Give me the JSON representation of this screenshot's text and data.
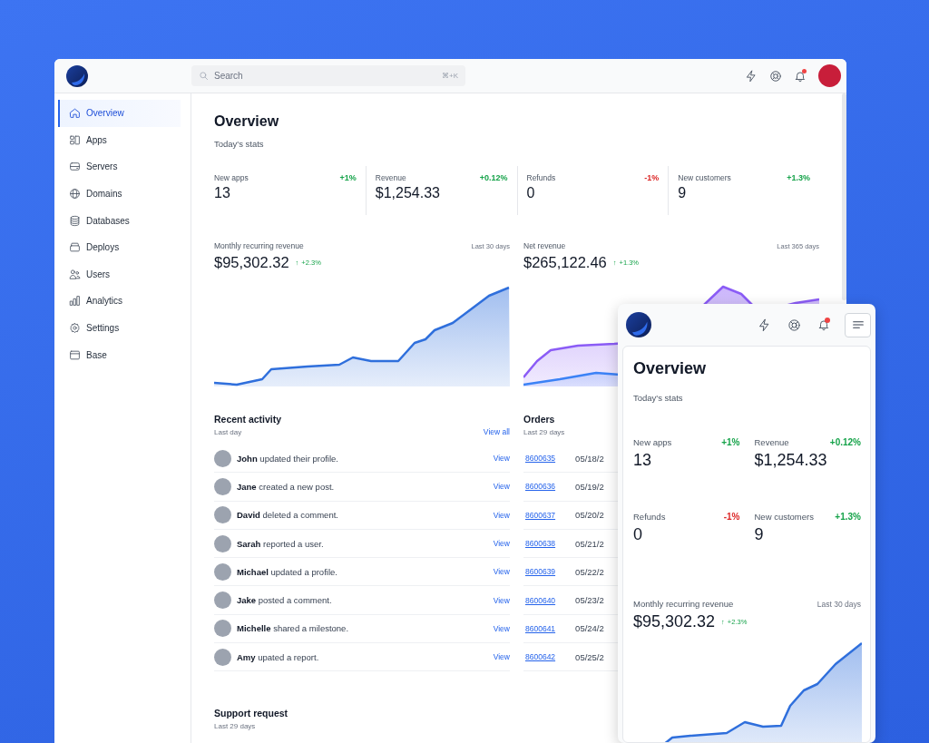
{
  "desktop": {
    "search": {
      "placeholder": "Search",
      "shortcut": "⌘+K"
    },
    "notifications": {
      "unread": true
    },
    "sidebar": {
      "items": [
        {
          "label": "Overview",
          "selected": true
        },
        {
          "label": "Apps",
          "selected": false
        },
        {
          "label": "Servers",
          "selected": false
        },
        {
          "label": "Domains",
          "selected": false
        },
        {
          "label": "Databases",
          "selected": false
        },
        {
          "label": "Deploys",
          "selected": false
        },
        {
          "label": "Users",
          "selected": false
        },
        {
          "label": "Analytics",
          "selected": false
        },
        {
          "label": "Settings",
          "selected": false
        },
        {
          "label": "Base",
          "selected": false
        }
      ]
    },
    "title": "Overview",
    "subtitle": "Today's stats",
    "stats": [
      {
        "label": "New apps",
        "value": "13",
        "change": "+1%",
        "color": "#16a34a"
      },
      {
        "label": "Revenue",
        "value": "$1,254.33",
        "change": "+0.12%",
        "color": "#16a34a"
      },
      {
        "label": "Refunds",
        "value": "0",
        "change": "-1%",
        "color": "#dc2626"
      },
      {
        "label": "New customers",
        "value": "9",
        "change": "+1.3%",
        "color": "#16a34a"
      }
    ],
    "charts": [
      {
        "kind": "single",
        "label": "Monthly recurring revenue",
        "period": "Last 30 days",
        "value": "$95,302.32",
        "arrow": "↑",
        "change": "+2.3%"
      },
      {
        "kind": "double",
        "label": "Net revenue",
        "period": "Last 365 days",
        "value": "$265,122.46",
        "arrow": "↑",
        "change": "+1.3%"
      }
    ],
    "activity": {
      "title": "Recent activity",
      "subtitle": "Last day",
      "link": "View all",
      "items": [
        {
          "text": "**John** updated their profile.",
          "link": "View"
        },
        {
          "text": "**Jane** created a new post.",
          "link": "View"
        },
        {
          "text": "**David** deleted a comment.",
          "link": "View"
        },
        {
          "text": "**Sarah** reported a user.",
          "link": "View"
        },
        {
          "text": "**Michael** updated a profile.",
          "link": "View"
        },
        {
          "text": "**Jake** posted a comment.",
          "link": "View"
        },
        {
          "text": "**Michelle** shared a milestone.",
          "link": "View"
        },
        {
          "text": "**Amy** upated a report.",
          "link": "View"
        }
      ]
    },
    "orders": {
      "title": "Orders",
      "subtitle": "Last 29 days",
      "rows": [
        {
          "id": "8600635",
          "date": "05/18/2"
        },
        {
          "id": "8600636",
          "date": "05/19/2"
        },
        {
          "id": "8600637",
          "date": "05/20/2"
        },
        {
          "id": "8600638",
          "date": "05/21/2"
        },
        {
          "id": "8600639",
          "date": "05/22/2"
        },
        {
          "id": "8600640",
          "date": "05/23/2"
        },
        {
          "id": "8600641",
          "date": "05/24/2"
        },
        {
          "id": "8600642",
          "date": "05/25/2"
        }
      ]
    },
    "support": {
      "title": "Support request",
      "subtitle": "Last 29 days"
    }
  },
  "mobile": {
    "notifications": {
      "unread": true
    },
    "title": "Overview",
    "subtitle": "Today's stats",
    "stats": [
      {
        "label": "New apps",
        "value": "13",
        "change": "+1%",
        "color": "#16a34a"
      },
      {
        "label": "Revenue",
        "value": "$1,254.33",
        "change": "+0.12%",
        "color": "#16a34a"
      },
      {
        "label": "Refunds",
        "value": "0",
        "change": "-1%",
        "color": "#dc2626"
      },
      {
        "label": "New customers",
        "value": "9",
        "change": "+1.3%",
        "color": "#16a34a"
      }
    ],
    "chart": {
      "kind": "single",
      "label": "Monthly recurring revenue",
      "period": "Last 30 days",
      "value": "$95,302.32",
      "arrow": "↑",
      "change": "+2.3%"
    }
  }
}
